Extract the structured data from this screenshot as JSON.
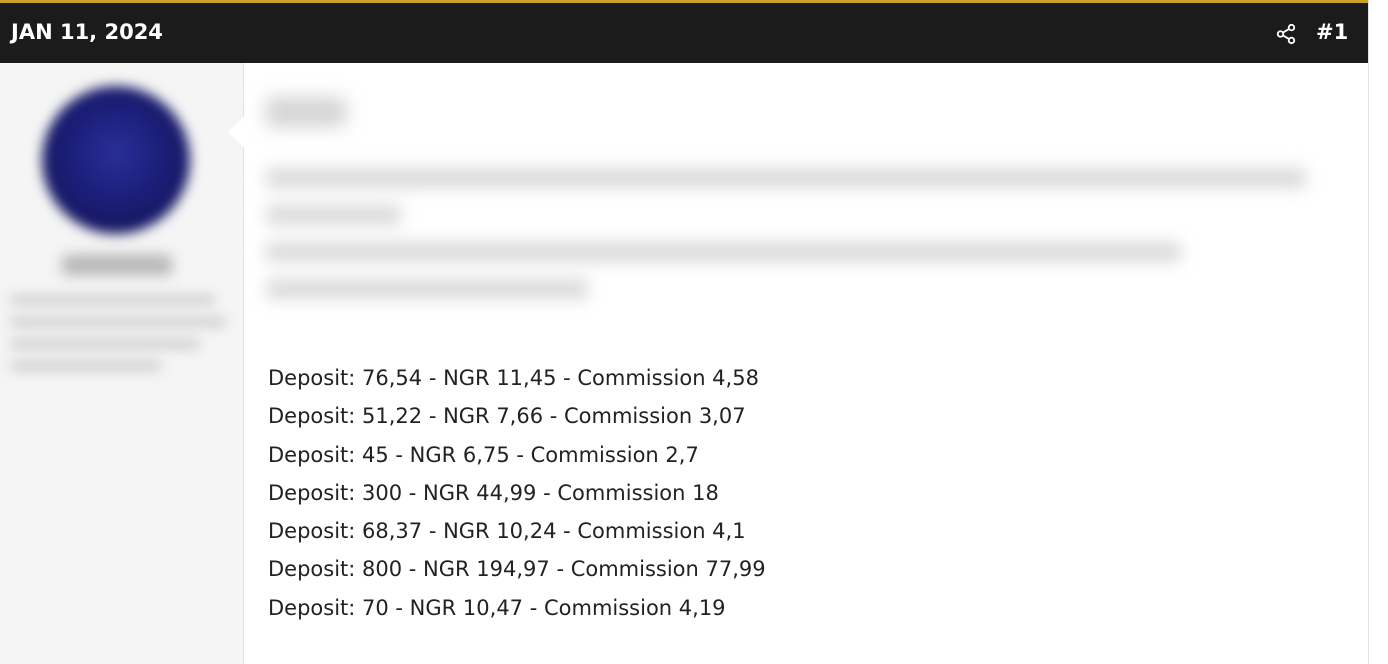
{
  "post": {
    "date": "JAN 11, 2024",
    "number": "#1",
    "share_icon": "share-icon"
  },
  "author": {
    "avatar_color": "#1c1f7a"
  },
  "colors": {
    "header_bg": "#1b1b1b",
    "header_accent": "#c9a227",
    "sidebar_bg": "#f5f5f5",
    "text": "#222222"
  },
  "lines": [
    "Deposit: 76,54 - NGR 11,45 - Commission 4,58",
    "Deposit: 51,22 - NGR 7,66 - Commission 3,07",
    "Deposit: 45 - NGR 6,75 - Commission 2,7",
    "Deposit: 300 - NGR 44,99 - Commission 18",
    "Deposit: 68,37 - NGR 10,24 - Commission 4,1",
    "Deposit: 800 - NGR 194,97 - Commission 77,99",
    "Deposit: 70 - NGR 10,47 - Commission 4,19"
  ]
}
